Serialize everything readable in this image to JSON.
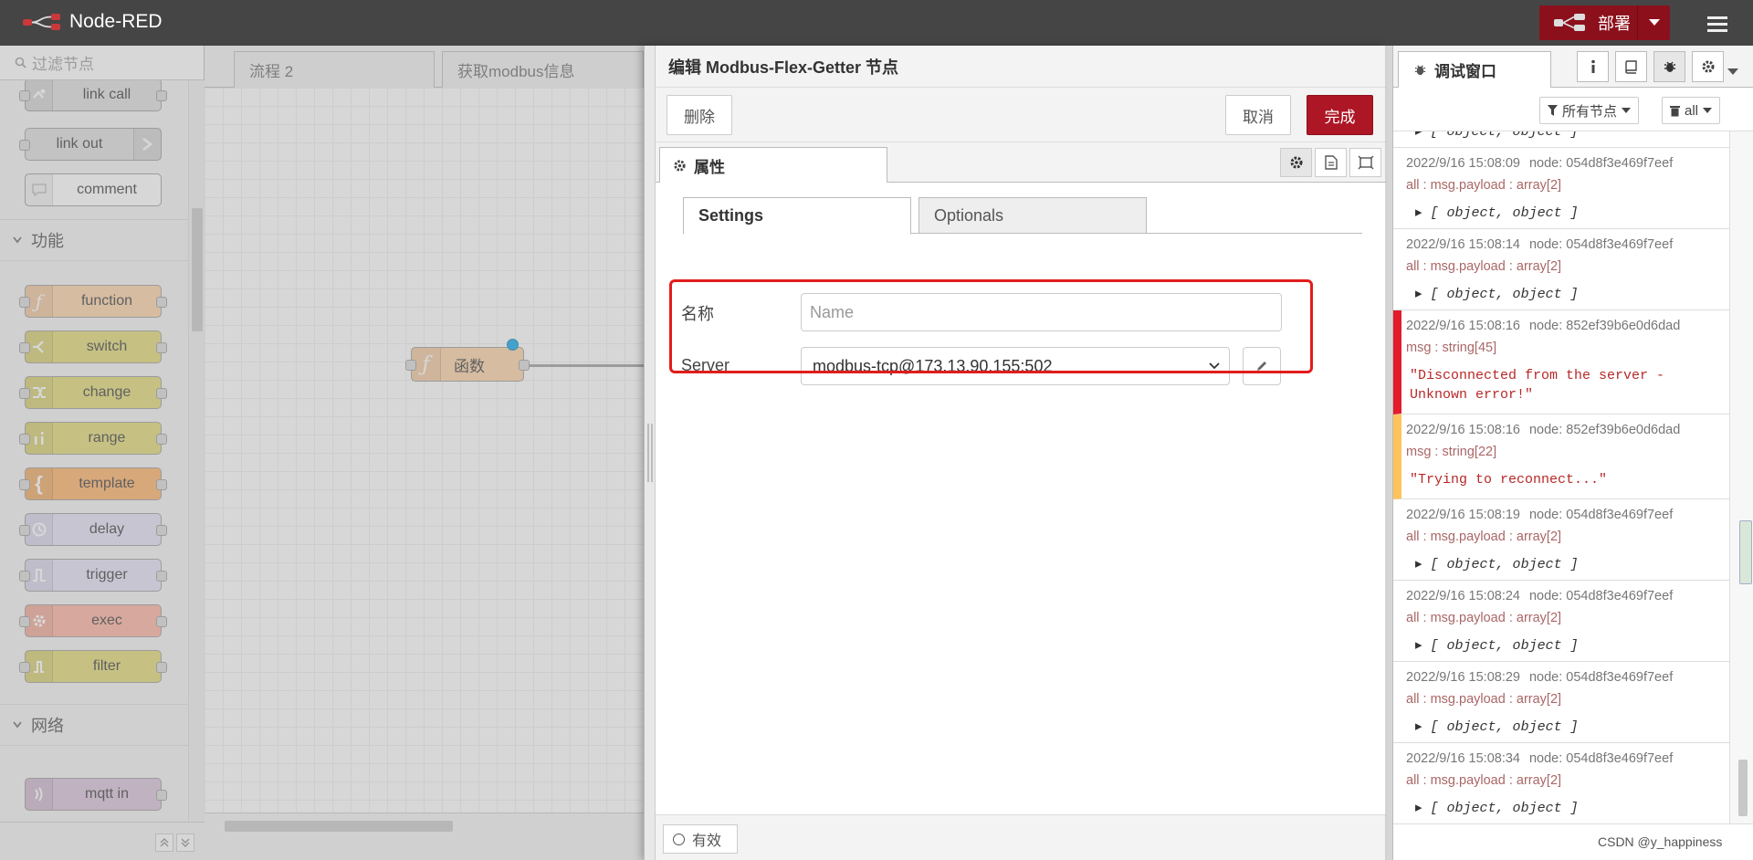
{
  "header": {
    "app_name": "Node-RED",
    "deploy_label": "部署",
    "colors": {
      "bar": "#454545",
      "deploy": "#8c101c"
    }
  },
  "palette": {
    "filter_placeholder": "过滤节点",
    "nodes_top": [
      {
        "label": "link call",
        "color": "#dddddd",
        "icon": "link-call-icon"
      },
      {
        "label": "link out",
        "color": "#dddddd",
        "icon": "link-out-icon"
      },
      {
        "label": "comment",
        "color": "#ffffff",
        "icon": "comment-icon"
      }
    ],
    "category_function": "功能",
    "nodes_function": [
      {
        "label": "function",
        "color": "#fdd0a2",
        "icon": "function-icon"
      },
      {
        "label": "switch",
        "color": "#e2d96e",
        "icon": "switch-icon"
      },
      {
        "label": "change",
        "color": "#e2d96e",
        "icon": "change-icon"
      },
      {
        "label": "range",
        "color": "#e2d96e",
        "icon": "range-icon"
      },
      {
        "label": "template",
        "color": "#ffaf60",
        "icon": "template-icon"
      },
      {
        "label": "delay",
        "color": "#e6e0f8",
        "icon": "delay-icon"
      },
      {
        "label": "trigger",
        "color": "#e6e0f8",
        "icon": "trigger-icon"
      },
      {
        "label": "exec",
        "color": "#ffaf9b",
        "icon": "exec-icon"
      },
      {
        "label": "filter",
        "color": "#e2d96e",
        "icon": "filter-icon"
      }
    ],
    "category_network": "网络",
    "nodes_network": [
      {
        "label": "mqtt in",
        "color": "#d8bfd8",
        "icon": "mqtt-icon"
      }
    ]
  },
  "workspace": {
    "tabs": [
      "流程 2",
      "获取modbus信息"
    ],
    "node_label": "函数"
  },
  "tray": {
    "title": "编辑 Modbus-Flex-Getter 节点",
    "delete_label": "删除",
    "cancel_label": "取消",
    "done_label": "完成",
    "props_tab_label": "属性",
    "sub_tabs": [
      "Settings",
      "Optionals"
    ],
    "name_label": "名称",
    "name_placeholder": "Name",
    "server_label": "Server",
    "server_value": "modbus-tcp@173.13.90.155:502",
    "enabled_label": "有效",
    "highlight_color": "#e21c1c"
  },
  "sidebar": {
    "debug_tab_label": "调试窗口",
    "filter_nodes_label": "所有节点",
    "clear_label": "all",
    "messages": [
      {
        "type": "object",
        "meta_time": "",
        "meta_node": "",
        "topic": "",
        "value": "[ object, object ]"
      },
      {
        "type": "object",
        "meta_time": "2022/9/16 15:08:09",
        "meta_node": "node: 054d8f3e469f7eef",
        "topic": "all : msg.payload : array[2]",
        "value": "[ object, object ]"
      },
      {
        "type": "object",
        "meta_time": "2022/9/16 15:08:14",
        "meta_node": "node: 054d8f3e469f7eef",
        "topic": "all : msg.payload : array[2]",
        "value": "[ object, object ]"
      },
      {
        "type": "error",
        "meta_time": "2022/9/16 15:08:16",
        "meta_node": "node: 852ef39b6e0d6dad",
        "topic": "msg : string[45]",
        "value": "\"Disconnected from the server - Unknown error!\""
      },
      {
        "type": "warn",
        "meta_time": "2022/9/16 15:08:16",
        "meta_node": "node: 852ef39b6e0d6dad",
        "topic": "msg : string[22]",
        "value": "\"Trying to reconnect...\""
      },
      {
        "type": "object",
        "meta_time": "2022/9/16 15:08:19",
        "meta_node": "node: 054d8f3e469f7eef",
        "topic": "all : msg.payload : array[2]",
        "value": "[ object, object ]"
      },
      {
        "type": "object",
        "meta_time": "2022/9/16 15:08:24",
        "meta_node": "node: 054d8f3e469f7eef",
        "topic": "all : msg.payload : array[2]",
        "value": "[ object, object ]"
      },
      {
        "type": "object",
        "meta_time": "2022/9/16 15:08:29",
        "meta_node": "node: 054d8f3e469f7eef",
        "topic": "all : msg.payload : array[2]",
        "value": "[ object, object ]"
      },
      {
        "type": "object",
        "meta_time": "2022/9/16 15:08:34",
        "meta_node": "node: 054d8f3e469f7eef",
        "topic": "all : msg.payload : array[2]",
        "value": "[ object, object ]"
      }
    ]
  },
  "watermark": "CSDN @y_happiness"
}
